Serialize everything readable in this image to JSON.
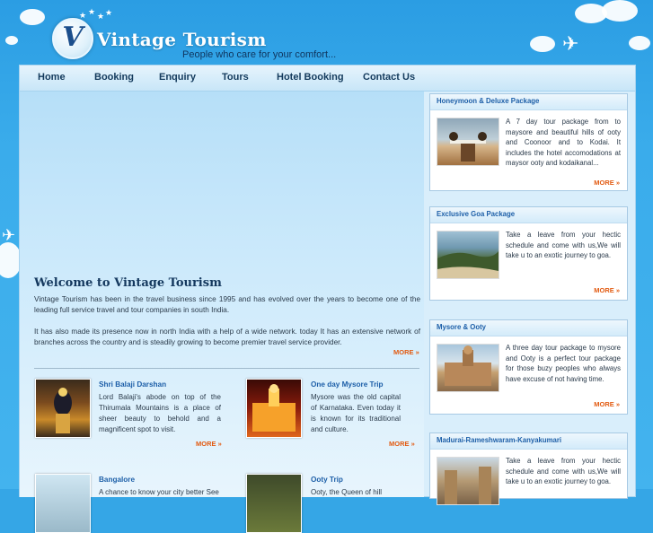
{
  "header": {
    "logo_letter": "V",
    "brand": "Vintage Tourism",
    "tagline": "People who care for your comfort..."
  },
  "nav": [
    {
      "label": "Home"
    },
    {
      "label": "Booking"
    },
    {
      "label": "Enquiry"
    },
    {
      "label": "Tours"
    },
    {
      "label": "Hotel Booking"
    },
    {
      "label": "Contact Us"
    }
  ],
  "welcome": {
    "title": "Welcome to Vintage Tourism",
    "para1": "Vintage Tourism has been in the travel business since 1995 and has evolved over the years to become one of the leading full service travel and tour companies in south India.",
    "para2": "It has also made its presence now in north India with a help of a wide network. today It has an extensive network of branches across the country and is steadily growing to become premier travel service provider.",
    "more": "MORE »"
  },
  "cards": [
    {
      "title": "Shri Balaji Darshan",
      "text": "Lord Balaji's abode on top of the Thirumala Mountains is a place of sheer beauty to behold and a magnificent spot to visit.",
      "more": "MORE »"
    },
    {
      "title": "One day Mysore Trip",
      "text": "Mysore was the old capital of Karnataka. Even today it is known for its traditional and culture.",
      "more": "MORE »"
    },
    {
      "title": "Bangalore",
      "text": "A chance to know your city better See"
    },
    {
      "title": "Ooty Trip",
      "text": "Ooty, the Queen of hill"
    }
  ],
  "sidebar": [
    {
      "title": "Honeymoon & Deluxe Package",
      "text": "A 7 day tour package from to maysore and beautiful hills of ooty and Coonoor and to Kodai. It includes the hotel accomodations at maysor ooty and kodaikanal...",
      "more": "MORE »"
    },
    {
      "title": "Exclusive Goa Package",
      "text": "Take a leave from your hectic schedule and come with us,We will take u to an exotic journey to goa.",
      "more": "MORE »"
    },
    {
      "title": "Mysore & Ooty",
      "text": "A three day tour package to mysore and Ooty is a perfect tour package for those buzy peoples who always have excuse of not having time.",
      "more": "MORE »"
    },
    {
      "title": "Madurai-Rameshwaram-Kanyakumari",
      "text": "Take a leave from your hectic schedule and come with us,We will take u to an exotic journey to goa."
    }
  ],
  "colors": {
    "accent": "#e25b12",
    "link": "#1d5fa8",
    "sky": "#35a6e6"
  }
}
